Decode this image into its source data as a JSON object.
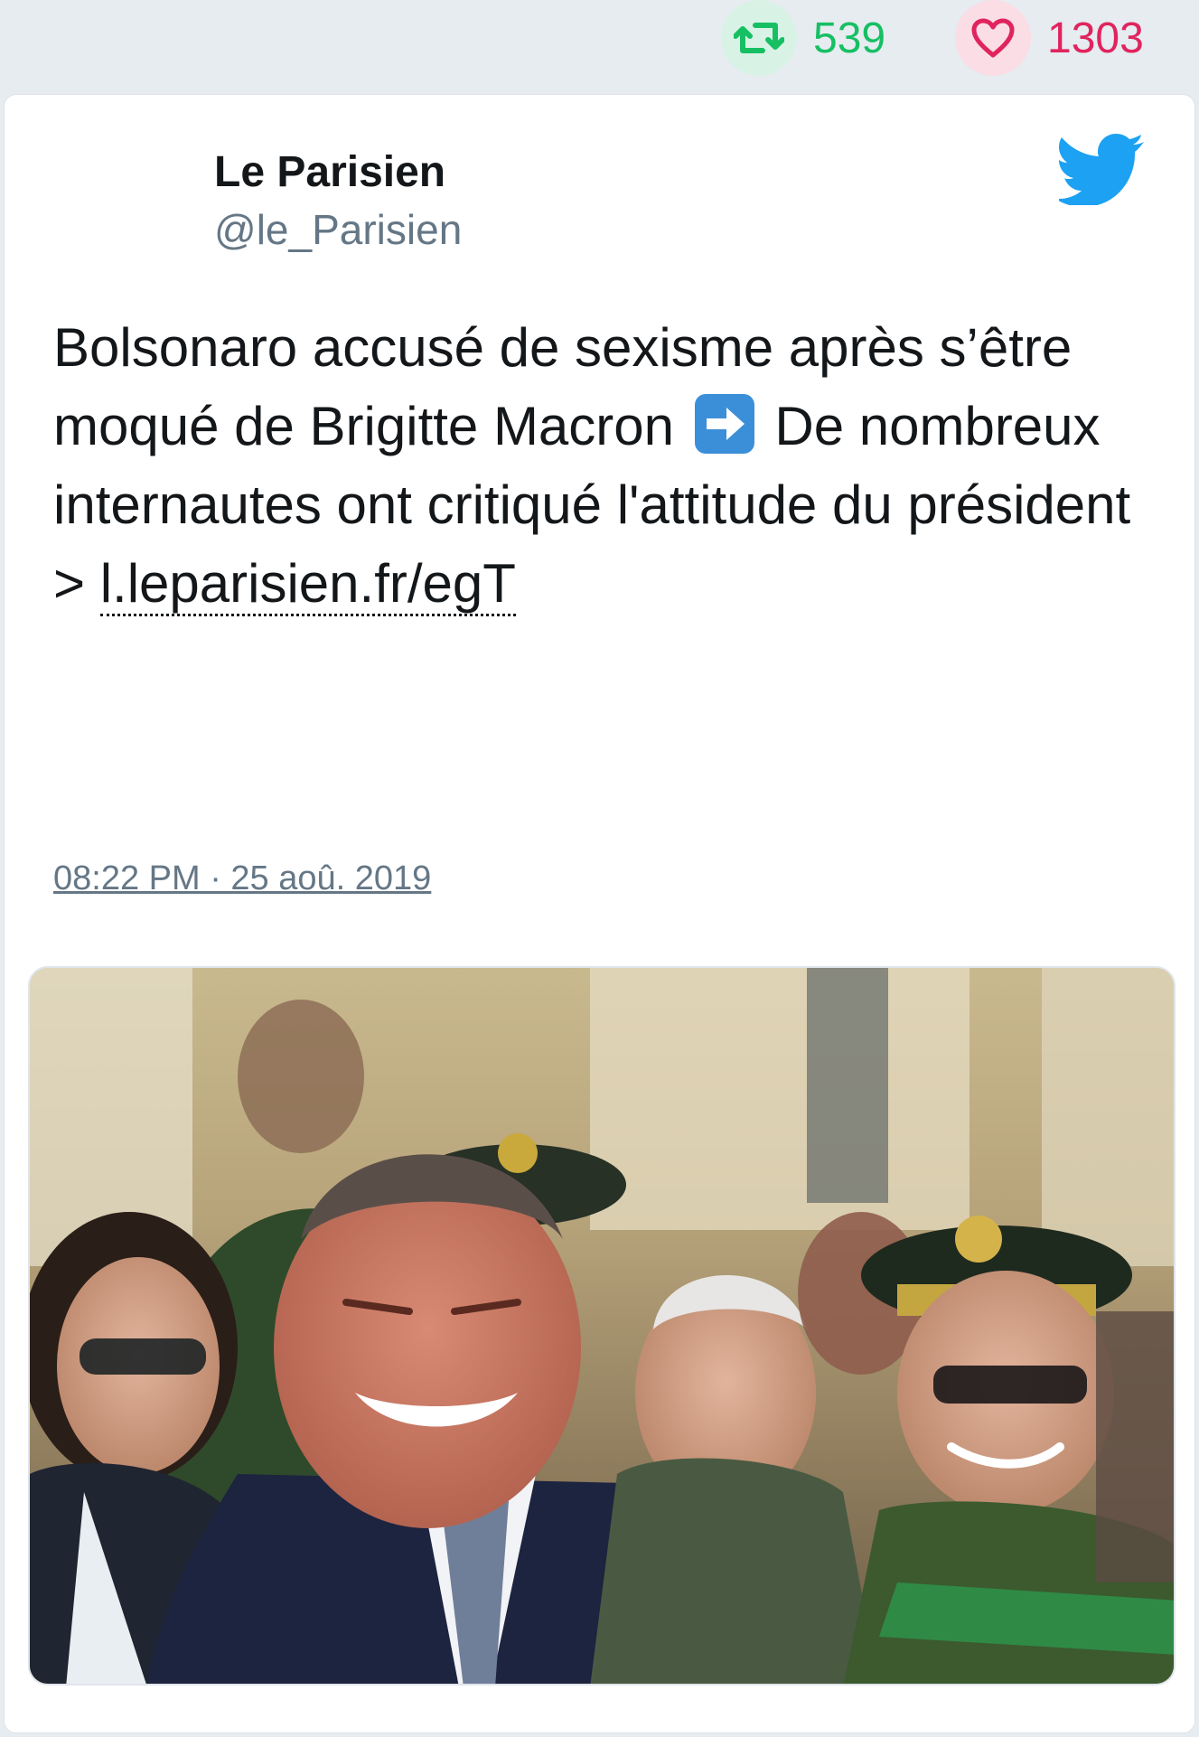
{
  "top_stats": {
    "retweets": "539",
    "likes": "1303",
    "retweet_icon": "retweet-icon",
    "like_icon": "heart-icon"
  },
  "tweet": {
    "display_name": "Le Parisien",
    "handle": "@le_Parisien",
    "text_part1": "Bolsonaro accusé de sexisme après s’être moqué de Brigitte Macron",
    "text_part2": "De nombreux internautes ont critiqué l'attitude du président >",
    "link": "l.leparisien.fr/egT",
    "timestamp": "08:22 PM · 25 aoû. 2019",
    "emoji_icon": "right-arrow-emoji",
    "brand_icon": "twitter-bird-icon"
  },
  "actions": {
    "reply_icon": "reply-icon",
    "retweet_icon": "retweet-icon",
    "like_icon": "heart-icon"
  },
  "media": {
    "type": "photo",
    "alt_icon": "photo-image"
  },
  "colors": {
    "retweet_green": "#17bf63",
    "like_pink": "#e0245e",
    "twitter_blue": "#1da1f2",
    "muted_text": "#657786",
    "background": "#e6ecf0"
  }
}
